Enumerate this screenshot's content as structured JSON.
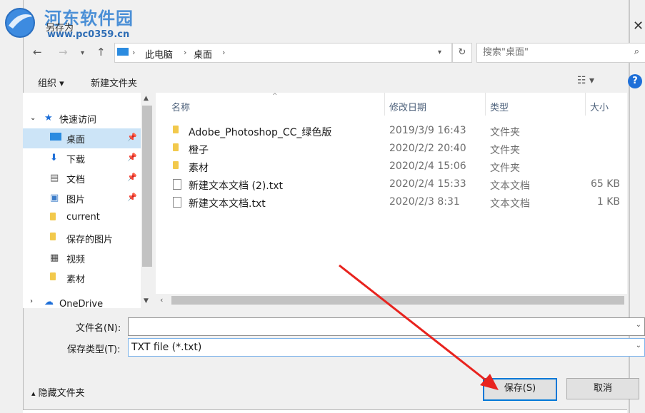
{
  "watermark": {
    "title": "河东软件园",
    "url": "www.pc0359.cn"
  },
  "dialog_title": "另存为",
  "address": {
    "segments": [
      "此电脑",
      "桌面"
    ]
  },
  "search": {
    "placeholder": "搜索\"桌面\""
  },
  "toolbar": {
    "organize": "组织 ▾",
    "new_folder": "新建文件夹",
    "help": "?"
  },
  "nav": [
    {
      "label": "快速访问",
      "icon": "star-icon"
    },
    {
      "label": "桌面",
      "icon": "desktop-icon",
      "selected": true,
      "pinned": true
    },
    {
      "label": "下载",
      "icon": "download-icon",
      "pinned": true
    },
    {
      "label": "文档",
      "icon": "document-icon",
      "pinned": true
    },
    {
      "label": "图片",
      "icon": "picture-icon",
      "pinned": true
    },
    {
      "label": "current",
      "icon": "folder-icon"
    },
    {
      "label": "保存的图片",
      "icon": "folder-icon"
    },
    {
      "label": "视频",
      "icon": "video-icon"
    },
    {
      "label": "素材",
      "icon": "folder-icon"
    },
    {
      "label": "OneDrive",
      "icon": "cloud-icon"
    }
  ],
  "columns": {
    "name": "名称",
    "modified": "修改日期",
    "type": "类型",
    "size": "大小"
  },
  "files": [
    {
      "name": "Adobe_Photoshop_CC_绿色版",
      "modified": "2019/3/9 16:43",
      "type": "文件夹",
      "size": "",
      "kind": "folder"
    },
    {
      "name": "橙子",
      "modified": "2020/2/2 20:40",
      "type": "文件夹",
      "size": "",
      "kind": "folder"
    },
    {
      "name": "素材",
      "modified": "2020/2/4 15:06",
      "type": "文件夹",
      "size": "",
      "kind": "folder"
    },
    {
      "name": "新建文本文档 (2).txt",
      "modified": "2020/2/4 15:33",
      "type": "文本文档",
      "size": "65 KB",
      "kind": "txt"
    },
    {
      "name": "新建文本文档.txt",
      "modified": "2020/2/3 8:31",
      "type": "文本文档",
      "size": "1 KB",
      "kind": "txt"
    }
  ],
  "form": {
    "filename_label": "文件名(N):",
    "filename_value": "",
    "filetype_label": "保存类型(T):",
    "filetype_value": "TXT file (*.txt)"
  },
  "footer": {
    "hide_folders": "隐藏文件夹",
    "save": "保存(S)",
    "cancel": "取消"
  },
  "colors": {
    "accent": "#0078d7",
    "selection": "#cce4f7",
    "annotation_arrow": "#e8231e"
  }
}
